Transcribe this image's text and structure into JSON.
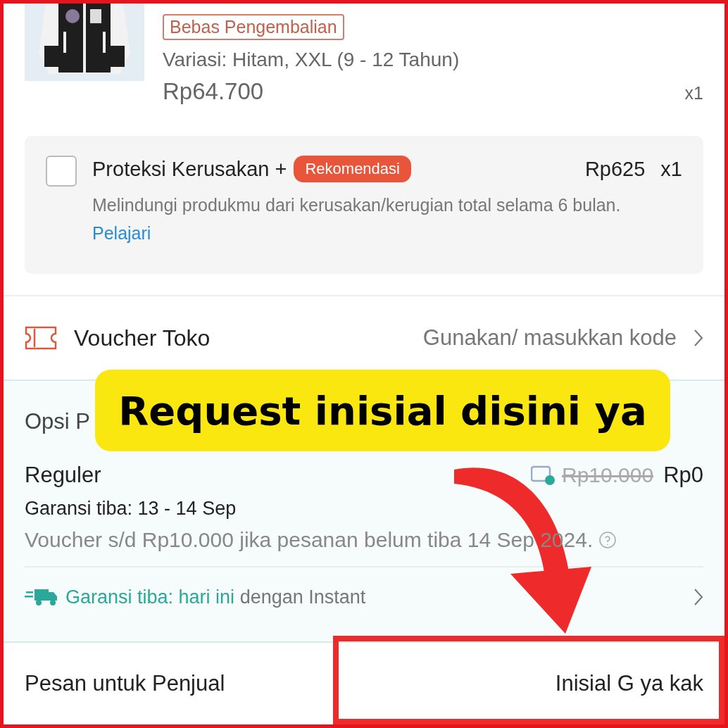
{
  "product": {
    "tag": "Bebas Pengembalian",
    "variation": "Variasi: Hitam, XXL (9 - 12 Tahun)",
    "price": "Rp64.700",
    "quantity": "x1"
  },
  "protection": {
    "checked": false,
    "title": "Proteksi Kerusakan +",
    "badge": "Rekomendasi",
    "price": "Rp625",
    "quantity": "x1",
    "description": "Melindungi produkmu dari kerusakan/kerugian total selama 6 bulan.",
    "link": "Pelajari"
  },
  "voucher": {
    "label": "Voucher Toko",
    "value": "Gunakan/ masukkan kode"
  },
  "shipping": {
    "heading": "Opsi P",
    "name": "Reguler",
    "old_price": "Rp10.000",
    "price": "Rp0",
    "guarantee": "Garansi tiba: 13 - 14 Sep",
    "voucher_note": "Voucher s/d Rp10.000 jika pesanan belum tiba 14 Sep 2024.",
    "instant_highlight": "Garansi tiba: hari ini",
    "instant_rest": "dengan Instant"
  },
  "message": {
    "label": "Pesan untuk Penjual",
    "value": "Inisial G ya kak",
    "highlighted": true
  },
  "annotation": {
    "text": "Request inisial disini ya"
  }
}
